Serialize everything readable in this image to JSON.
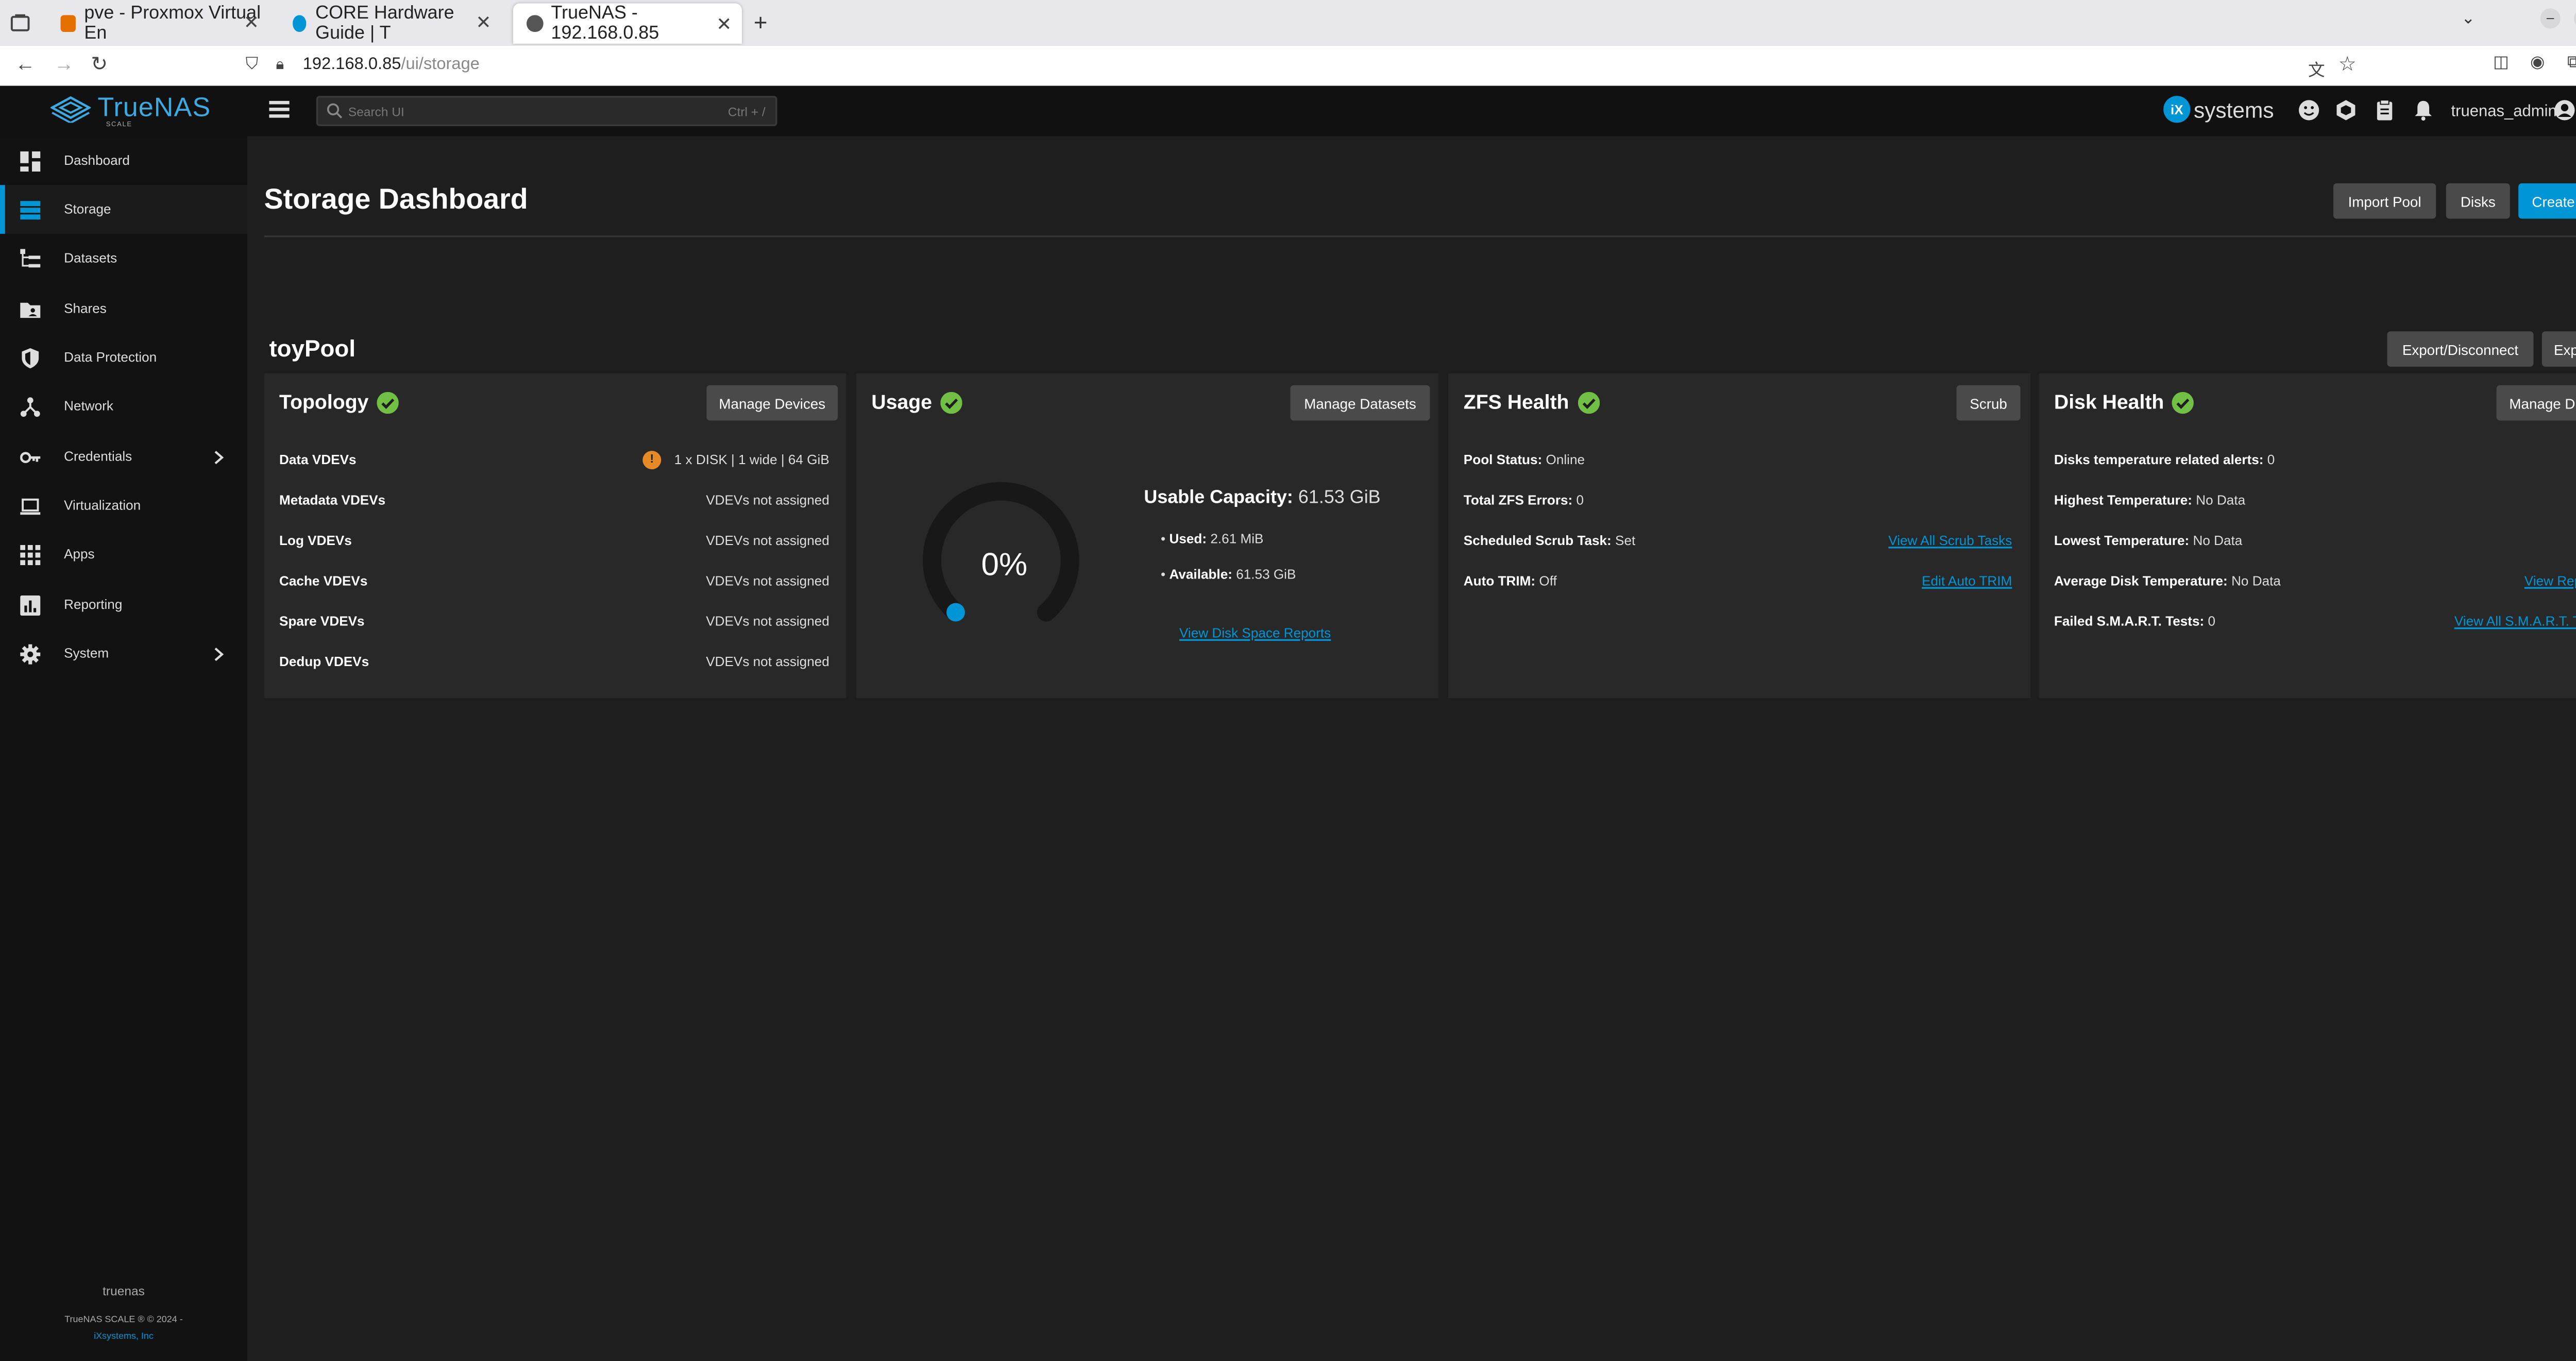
{
  "browser": {
    "tabs": [
      {
        "title": "pve - Proxmox Virtual En"
      },
      {
        "title": "CORE Hardware Guide | T"
      },
      {
        "title": "TrueNAS - 192.168.0.85"
      }
    ],
    "url_host": "192.168.0.85",
    "url_path": "/ui/storage"
  },
  "header": {
    "app_name": "TrueNAS",
    "edition": "SCALE",
    "search_placeholder": "Search UI",
    "search_shortcut": "Ctrl + /",
    "brand_ix": "iX",
    "brand_systems": "systems",
    "username": "truenas_admin"
  },
  "sidebar": {
    "items": [
      {
        "label": "Dashboard"
      },
      {
        "label": "Storage"
      },
      {
        "label": "Datasets"
      },
      {
        "label": "Shares"
      },
      {
        "label": "Data Protection"
      },
      {
        "label": "Network"
      },
      {
        "label": "Credentials"
      },
      {
        "label": "Virtualization"
      },
      {
        "label": "Apps"
      },
      {
        "label": "Reporting"
      },
      {
        "label": "System"
      }
    ],
    "hostname": "truenas",
    "copyright": "TrueNAS SCALE ® © 2024 -",
    "company": "iXsystems, Inc"
  },
  "page": {
    "title": "Storage Dashboard",
    "buttons": {
      "import_pool": "Import Pool",
      "disks": "Disks",
      "create_pool": "Create Pool"
    }
  },
  "pool": {
    "name": "toyPool",
    "buttons": {
      "export": "Export/Disconnect",
      "expand": "Expand"
    },
    "topology": {
      "title": "Topology",
      "button": "Manage Devices",
      "rows": [
        {
          "label": "Data VDEVs",
          "value": "1 x DISK | 1 wide | 64 GiB"
        },
        {
          "label": "Metadata VDEVs",
          "value": "VDEVs not assigned"
        },
        {
          "label": "Log VDEVs",
          "value": "VDEVs not assigned"
        },
        {
          "label": "Cache VDEVs",
          "value": "VDEVs not assigned"
        },
        {
          "label": "Spare VDEVs",
          "value": "VDEVs not assigned"
        },
        {
          "label": "Dedup VDEVs",
          "value": "VDEVs not assigned"
        }
      ]
    },
    "usage": {
      "title": "Usage",
      "button": "Manage Datasets",
      "percent_label": "0%",
      "percent": 0,
      "capacity_label": "Usable Capacity:",
      "capacity_value": "61.53 GiB",
      "used_label": "Used:",
      "used_value": "2.61 MiB",
      "available_label": "Available:",
      "available_value": "61.53 GiB",
      "link": "View Disk Space Reports"
    },
    "zfs": {
      "title": "ZFS Health",
      "button": "Scrub",
      "rows": [
        {
          "label": "Pool Status:",
          "value": "Online"
        },
        {
          "label": "Total ZFS Errors:",
          "value": "0"
        },
        {
          "label": "Scheduled Scrub Task:",
          "value": "Set"
        },
        {
          "label": "Auto TRIM:",
          "value": "Off"
        }
      ],
      "link_scrub": "View All Scrub Tasks",
      "link_trim": "Edit Auto TRIM"
    },
    "disk": {
      "title": "Disk Health",
      "button": "Manage Disks",
      "rows": [
        {
          "label": "Disks temperature related alerts:",
          "value": "0"
        },
        {
          "label": "Highest Temperature:",
          "value": "No Data"
        },
        {
          "label": "Lowest Temperature:",
          "value": "No Data"
        },
        {
          "label": "Average Disk Temperature:",
          "value": "No Data"
        },
        {
          "label": "Failed S.M.A.R.T. Tests:",
          "value": "0"
        }
      ],
      "link_reports": "View Reports",
      "link_smart": "View All S.M.A.R.T. Tests"
    }
  },
  "colors": {
    "accent": "#0095d5",
    "ok": "#71bf44",
    "warn": "#e58a25"
  }
}
